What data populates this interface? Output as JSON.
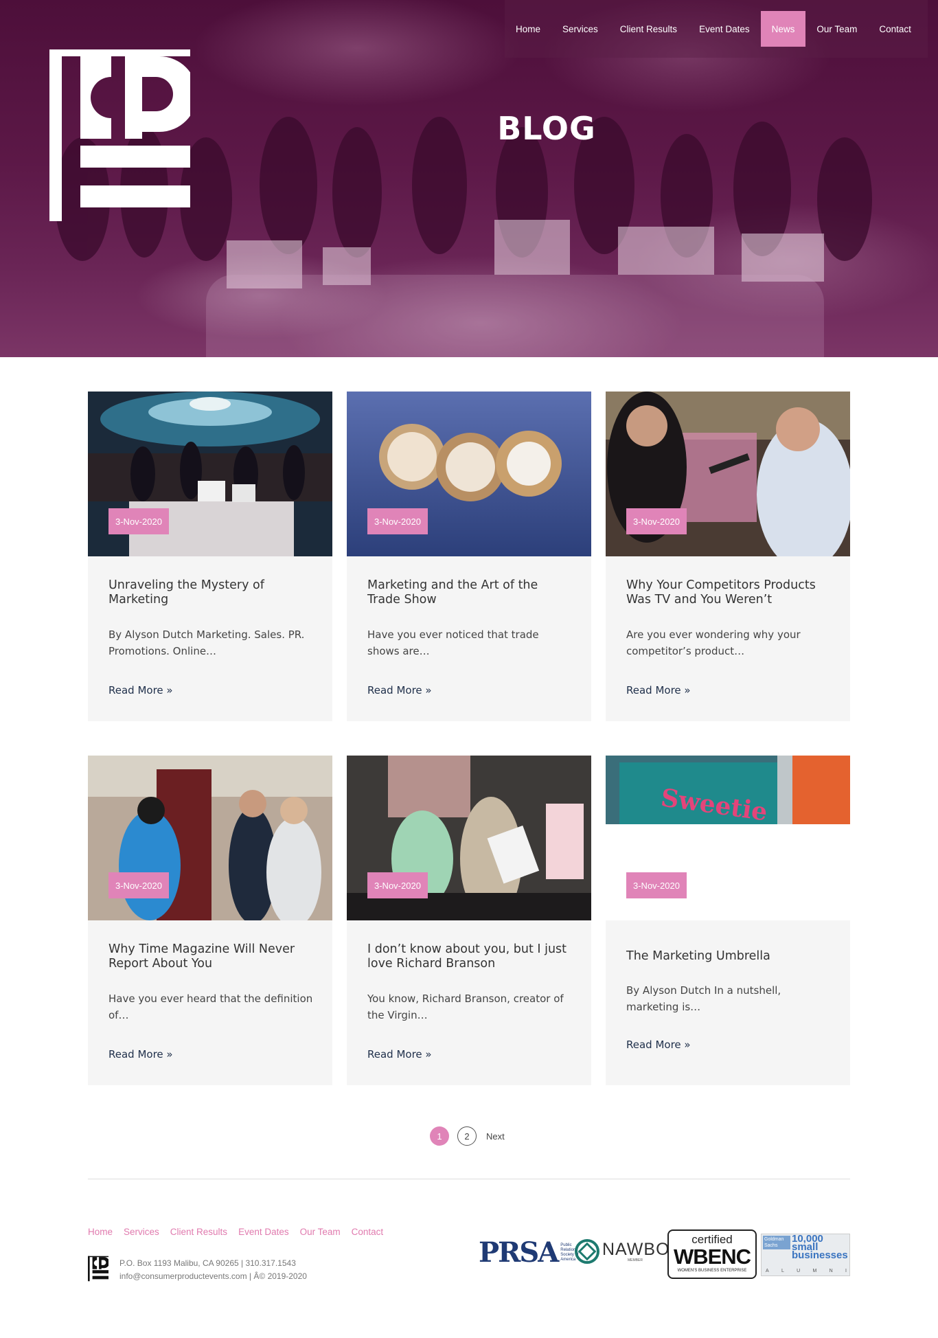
{
  "nav": {
    "items": [
      {
        "label": "Home",
        "active": false
      },
      {
        "label": "Services",
        "active": false
      },
      {
        "label": "Client Results",
        "active": false
      },
      {
        "label": "Event Dates",
        "active": false
      },
      {
        "label": "News",
        "active": true
      },
      {
        "label": "Our Team",
        "active": false
      },
      {
        "label": "Contact",
        "active": false
      }
    ]
  },
  "hero": {
    "title": "BLOG"
  },
  "colors": {
    "accent": "#e084b8",
    "hero_overlay": "#5c1847",
    "link": "#1f2f4a",
    "footer_link": "#e07aae"
  },
  "posts": [
    {
      "date": "3-Nov-2020",
      "title": "Unraveling the Mystery of Marketing",
      "excerpt": "By Alyson Dutch Marketing. Sales. PR. Promotions. Online…",
      "more": "Read More »"
    },
    {
      "date": "3-Nov-2020",
      "title": "Marketing and the Art of the Trade Show",
      "excerpt": "Have you ever noticed that trade shows are…",
      "more": "Read More »"
    },
    {
      "date": "3-Nov-2020",
      "title": "Why Your Competitors Products Was TV and You Weren’t",
      "excerpt": "Are you ever wondering why your competitor’s product…",
      "more": "Read More »"
    },
    {
      "date": "3-Nov-2020",
      "title": "Why Time Magazine Will Never Report About You",
      "excerpt": "Have you ever heard that the definition of…",
      "more": "Read More »"
    },
    {
      "date": "3-Nov-2020",
      "title": "I don’t know about you, but I just love Richard Branson",
      "excerpt": "You know, Richard Branson, creator of the Virgin…",
      "more": "Read More »"
    },
    {
      "date": "3-Nov-2020",
      "title": "The Marketing Umbrella",
      "excerpt": "By Alyson Dutch In a nutshell, marketing is…",
      "more": "Read More »"
    }
  ],
  "pagination": {
    "current": "1",
    "next_page": "2",
    "next_label": "Next"
  },
  "footer": {
    "links": [
      "Home",
      "Services",
      "Client Results",
      "Event Dates",
      "Our Team",
      "Contact"
    ],
    "address_line1": "P.O. Box 1193 Malibu, CA 90265 | 310.317.1543",
    "address_line2": "info@consumerproductevents.com | Â© 2019-2020",
    "badges": {
      "prsa": "PRSA",
      "prsa_sub": "Public Relations Society of America",
      "nawbo": "NAWBO",
      "nawbo_sub": "MEMBER",
      "wbenc_cert": "certified",
      "wbenc": "WBENC",
      "wbenc_sub": "WOMEN'S BUSINESS ENTERPRISE",
      "gs_logo": "Goldman Sachs",
      "gs_text": "10,000 small businesses",
      "gs_alumni": [
        "A",
        "L",
        "U",
        "M",
        "N",
        "I"
      ]
    }
  }
}
